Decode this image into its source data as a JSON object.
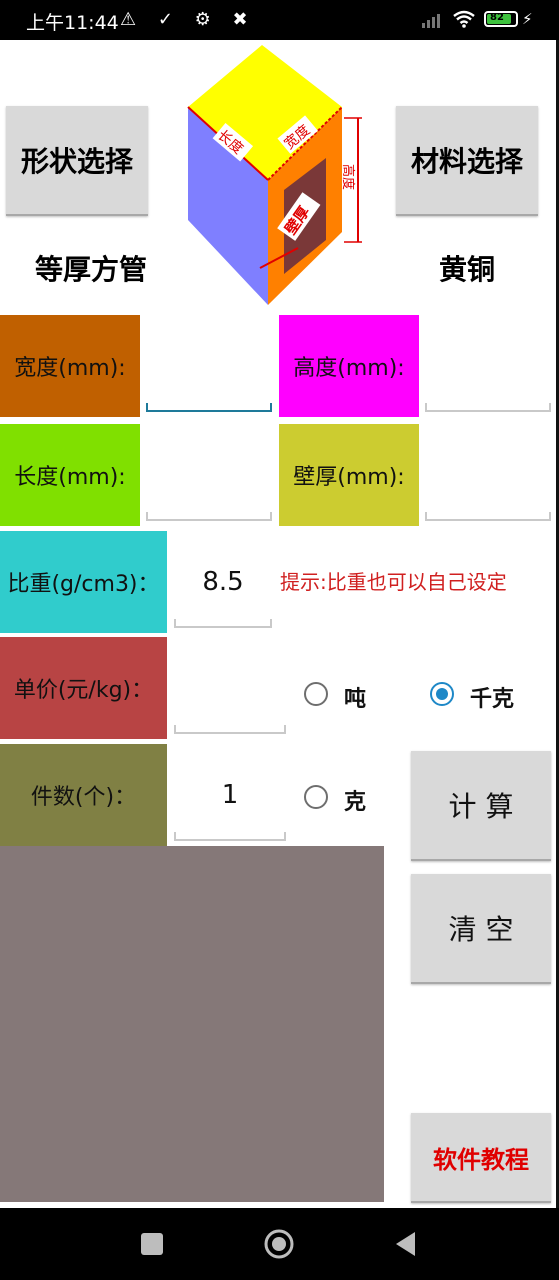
{
  "status_bar": {
    "time": "上午11:44",
    "battery": "82",
    "left_icons": "⚠ ✓ ⚙ ✖"
  },
  "header": {
    "shape_button": "形状选择",
    "material_button": "材料选择",
    "shape_value": "等厚方管",
    "material_value": "黄铜",
    "diagram_labels": {
      "length": "长度",
      "width": "宽度",
      "height": "高度",
      "thickness": "壁厚"
    }
  },
  "fields": {
    "width": {
      "label": "宽度(mm):",
      "value": "",
      "color": "#c06000"
    },
    "height": {
      "label": "高度(mm):",
      "value": "",
      "color": "#ff00ff"
    },
    "length": {
      "label": "长度(mm):",
      "value": "",
      "color": "#80e000"
    },
    "thickness": {
      "label": "壁厚(mm):",
      "value": "",
      "color": "#cccc30"
    },
    "density": {
      "label": "比重(g/cm3)：",
      "value": "8.5",
      "color": "#30cccc"
    },
    "price": {
      "label": "单价(元/kg)：",
      "value": "",
      "color": "#b84444"
    },
    "count": {
      "label": "件数(个)：",
      "value": "1",
      "color": "#808044"
    }
  },
  "hint": "提示:比重也可以自己设定",
  "units": {
    "ton": "吨",
    "kilogram": "千克",
    "gram": "克",
    "selected": "kilogram"
  },
  "buttons": {
    "calculate": "计 算",
    "clear": "清 空",
    "tutorial": "软件教程"
  },
  "colors": {
    "result_area": "#857878",
    "hint_text": "#d02020",
    "tutorial_text": "#e00000",
    "accent": "#1e88c7"
  }
}
